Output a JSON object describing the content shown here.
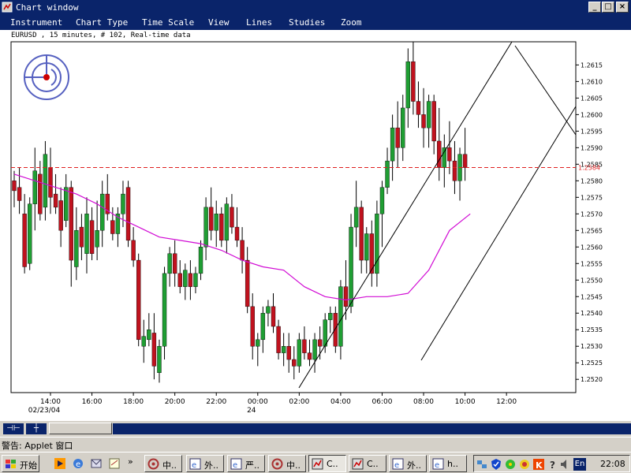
{
  "window": {
    "title": "Chart window",
    "buttons": {
      "minimize": "_",
      "maximize": "□",
      "close": "×"
    }
  },
  "menu": [
    "Instrument",
    "Chart Type",
    "Time Scale",
    "View",
    "Lines",
    "Studies",
    "Zoom"
  ],
  "info_line": "EURUSD , 15 minutes, # 102, Real-time data",
  "status_text": "警告: Applet 窗口",
  "scroll_buttons": [
    "⊣⊢",
    "┼"
  ],
  "taskbar": {
    "start_label": "开始",
    "tasks": [
      {
        "label": "中..",
        "icon": "app-icon",
        "active": false
      },
      {
        "label": "外..",
        "icon": "browser-icon",
        "active": false
      },
      {
        "label": "严..",
        "icon": "browser-icon",
        "active": false
      },
      {
        "label": "中..",
        "icon": "app-icon",
        "active": false
      },
      {
        "label": "C..",
        "icon": "chart-app-icon",
        "active": true
      },
      {
        "label": "C..",
        "icon": "chart-app-icon",
        "active": false
      },
      {
        "label": "外..",
        "icon": "browser-icon",
        "active": false
      },
      {
        "label": "h..",
        "icon": "browser-icon",
        "active": false
      }
    ],
    "clock": "22:08",
    "ime": "En"
  },
  "colors": {
    "bull": "#1f9e33",
    "bear": "#c0121e",
    "ma": "#d10bd4",
    "price_line": "#e02020",
    "titlebar": "#0a246a",
    "background": "#ffffff"
  },
  "chart_data": {
    "type": "candlestick",
    "symbol": "EURUSD",
    "timeframe": "15 minutes",
    "current_price_label": "1.2584",
    "current_price": 1.2584,
    "ylim": [
      1.2516,
      1.2622
    ],
    "yticks": [
      "1.2520",
      "1.2525",
      "1.2530",
      "1.2535",
      "1.2540",
      "1.2545",
      "1.2550",
      "1.2555",
      "1.2560",
      "1.2565",
      "1.2570",
      "1.2575",
      "1.2580",
      "1.2585",
      "1.2590",
      "1.2595",
      "1.2600",
      "1.2605",
      "1.2610",
      "1.2615"
    ],
    "xticks": [
      {
        "label": "14:00",
        "sub": "02/23/04",
        "bar": 7
      },
      {
        "label": "16:00",
        "sub": "",
        "bar": 15
      },
      {
        "label": "18:00",
        "sub": "",
        "bar": 23
      },
      {
        "label": "20:00",
        "sub": "",
        "bar": 31
      },
      {
        "label": "22:00",
        "sub": "",
        "bar": 39
      },
      {
        "label": "00:00",
        "sub": "24",
        "bar": 47
      },
      {
        "label": "02:00",
        "sub": "",
        "bar": 55
      },
      {
        "label": "04:00",
        "sub": "",
        "bar": 63
      },
      {
        "label": "06:00",
        "sub": "",
        "bar": 71
      },
      {
        "label": "08:00",
        "sub": "",
        "bar": 79
      },
      {
        "label": "10:00",
        "sub": "",
        "bar": 87
      },
      {
        "label": "12:00",
        "sub": "",
        "bar": 95
      }
    ],
    "candles": [
      [
        1.258,
        1.2583,
        1.2572,
        1.2577
      ],
      [
        1.2578,
        1.2584,
        1.257,
        1.2574
      ],
      [
        1.257,
        1.2576,
        1.2552,
        1.2554
      ],
      [
        1.2555,
        1.2575,
        1.2553,
        1.2573
      ],
      [
        1.2573,
        1.259,
        1.2565,
        1.2583
      ],
      [
        1.2582,
        1.2586,
        1.2568,
        1.257
      ],
      [
        1.2572,
        1.2592,
        1.2568,
        1.2588
      ],
      [
        1.2584,
        1.259,
        1.257,
        1.2575
      ],
      [
        1.2576,
        1.2582,
        1.257,
        1.2572
      ],
      [
        1.2574,
        1.2578,
        1.256,
        1.2565
      ],
      [
        1.2568,
        1.2582,
        1.2566,
        1.2578
      ],
      [
        1.2578,
        1.258,
        1.2548,
        1.2556
      ],
      [
        1.2554,
        1.2572,
        1.255,
        1.2565
      ],
      [
        1.2566,
        1.257,
        1.2556,
        1.256
      ],
      [
        1.2558,
        1.2575,
        1.2552,
        1.257
      ],
      [
        1.2568,
        1.2572,
        1.2556,
        1.2558
      ],
      [
        1.256,
        1.2574,
        1.2556,
        1.2565
      ],
      [
        1.2565,
        1.258,
        1.256,
        1.2576
      ],
      [
        1.2576,
        1.2582,
        1.2568,
        1.257
      ],
      [
        1.2568,
        1.2572,
        1.2562,
        1.2564
      ],
      [
        1.2564,
        1.2572,
        1.256,
        1.257
      ],
      [
        1.257,
        1.258,
        1.2566,
        1.2576
      ],
      [
        1.2578,
        1.258,
        1.256,
        1.2562
      ],
      [
        1.2562,
        1.2566,
        1.2554,
        1.2556
      ],
      [
        1.2556,
        1.2558,
        1.253,
        1.2532
      ],
      [
        1.253,
        1.2538,
        1.2525,
        1.2533
      ],
      [
        1.2532,
        1.254,
        1.253,
        1.2535
      ],
      [
        1.2534,
        1.254,
        1.252,
        1.2524
      ],
      [
        1.2522,
        1.2532,
        1.2519,
        1.253
      ],
      [
        1.253,
        1.2554,
        1.2526,
        1.2552
      ],
      [
        1.2552,
        1.256,
        1.2548,
        1.2558
      ],
      [
        1.2558,
        1.2562,
        1.2548,
        1.2552
      ],
      [
        1.2552,
        1.2556,
        1.2546,
        1.2548
      ],
      [
        1.2548,
        1.2555,
        1.2544,
        1.2553
      ],
      [
        1.2552,
        1.2556,
        1.2544,
        1.2548
      ],
      [
        1.2548,
        1.2554,
        1.2546,
        1.2552
      ],
      [
        1.2552,
        1.2562,
        1.255,
        1.256
      ],
      [
        1.256,
        1.2575,
        1.2556,
        1.2572
      ],
      [
        1.2572,
        1.2578,
        1.2562,
        1.2565
      ],
      [
        1.2565,
        1.2574,
        1.256,
        1.257
      ],
      [
        1.257,
        1.2572,
        1.256,
        1.2562
      ],
      [
        1.2562,
        1.2575,
        1.2558,
        1.2573
      ],
      [
        1.2572,
        1.2576,
        1.2564,
        1.2566
      ],
      [
        1.2566,
        1.2572,
        1.256,
        1.2562
      ],
      [
        1.2562,
        1.2566,
        1.2552,
        1.2556
      ],
      [
        1.2556,
        1.256,
        1.254,
        1.2542
      ],
      [
        1.2542,
        1.2546,
        1.2526,
        1.253
      ],
      [
        1.253,
        1.2534,
        1.2524,
        1.2532
      ],
      [
        1.2532,
        1.2542,
        1.2528,
        1.254
      ],
      [
        1.254,
        1.2544,
        1.2536,
        1.2542
      ],
      [
        1.2542,
        1.2546,
        1.2534,
        1.2536
      ],
      [
        1.2536,
        1.2538,
        1.2526,
        1.2528
      ],
      [
        1.2528,
        1.2534,
        1.2524,
        1.253
      ],
      [
        1.253,
        1.2534,
        1.2522,
        1.2526
      ],
      [
        1.2526,
        1.253,
        1.252,
        1.2524
      ],
      [
        1.2524,
        1.2534,
        1.2522,
        1.2532
      ],
      [
        1.2532,
        1.2536,
        1.2526,
        1.2528
      ],
      [
        1.2528,
        1.2532,
        1.2524,
        1.2526
      ],
      [
        1.2526,
        1.2534,
        1.2522,
        1.2532
      ],
      [
        1.2532,
        1.2536,
        1.2526,
        1.253
      ],
      [
        1.253,
        1.254,
        1.2528,
        1.2538
      ],
      [
        1.2538,
        1.2542,
        1.2534,
        1.254
      ],
      [
        1.254,
        1.2542,
        1.2528,
        1.253
      ],
      [
        1.253,
        1.255,
        1.2526,
        1.2548
      ],
      [
        1.2548,
        1.2556,
        1.2538,
        1.2542
      ],
      [
        1.2542,
        1.257,
        1.254,
        1.2566
      ],
      [
        1.2566,
        1.258,
        1.256,
        1.2572
      ],
      [
        1.2572,
        1.2574,
        1.2552,
        1.2556
      ],
      [
        1.2556,
        1.2566,
        1.2552,
        1.2564
      ],
      [
        1.2564,
        1.2568,
        1.2548,
        1.2552
      ],
      [
        1.2552,
        1.2574,
        1.2548,
        1.257
      ],
      [
        1.257,
        1.258,
        1.256,
        1.2578
      ],
      [
        1.2578,
        1.259,
        1.2576,
        1.2586
      ],
      [
        1.2586,
        1.26,
        1.258,
        1.2596
      ],
      [
        1.2596,
        1.2604,
        1.2584,
        1.259
      ],
      [
        1.259,
        1.2606,
        1.2586,
        1.2602
      ],
      [
        1.2602,
        1.262,
        1.2596,
        1.2616
      ],
      [
        1.2616,
        1.2622,
        1.26,
        1.2604
      ],
      [
        1.2604,
        1.261,
        1.2596,
        1.26
      ],
      [
        1.26,
        1.2608,
        1.259,
        1.2596
      ],
      [
        1.2596,
        1.2606,
        1.259,
        1.2604
      ],
      [
        1.2604,
        1.2606,
        1.2588,
        1.2592
      ],
      [
        1.2592,
        1.2602,
        1.258,
        1.2584
      ],
      [
        1.2584,
        1.2594,
        1.2578,
        1.259
      ],
      [
        1.259,
        1.2598,
        1.2582,
        1.2586
      ],
      [
        1.2586,
        1.2592,
        1.2576,
        1.258
      ],
      [
        1.258,
        1.259,
        1.2574,
        1.2588
      ],
      [
        1.2588,
        1.2596,
        1.258,
        1.2584
      ]
    ],
    "moving_average": [
      1.2582,
      1.258,
      1.2578,
      1.2576,
      1.2573,
      1.2569,
      1.2566,
      1.2563,
      1.2562,
      1.2561,
      1.2559,
      1.2556,
      1.2554,
      1.2553,
      1.2548,
      1.2545,
      1.2544,
      1.2545,
      1.2545,
      1.2546,
      1.2553,
      1.2565,
      1.257
    ],
    "ma_start_bar": 0,
    "ma_step_bars": 4
  }
}
